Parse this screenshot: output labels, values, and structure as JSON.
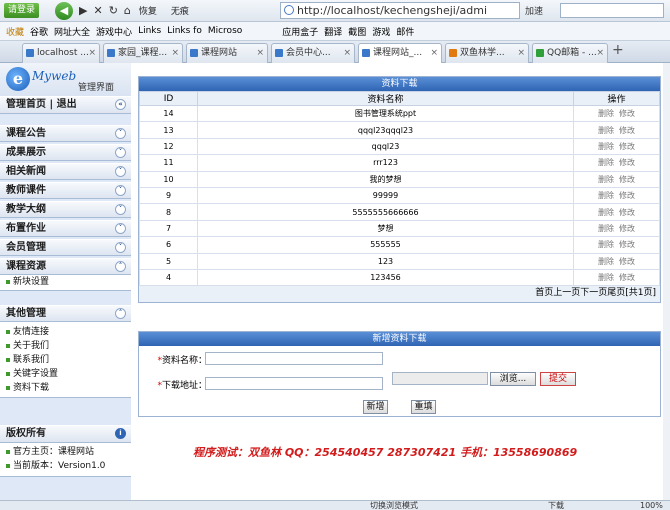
{
  "browser": {
    "login_label": "请登录",
    "back": "◀",
    "forward": "▶",
    "menu_favorites": "收藏",
    "btn_restore": "恢复",
    "btn_noplugin": "无痕",
    "address": "http://localhost/kechengsheji/admi",
    "accelerate": "加速",
    "bookmarks": [
      "收藏",
      "谷歌",
      "网址大全",
      "游戏中心",
      "Links",
      "Links fo",
      "Microso"
    ],
    "right_tools": [
      "应用盒子",
      "翻译",
      "截图",
      "游戏",
      "邮件"
    ],
    "tabs": [
      {
        "label": "localhost ...",
        "active": false
      },
      {
        "label": "家园_课程...",
        "active": false
      },
      {
        "label": "课程网站",
        "active": false
      },
      {
        "label": "会员中心...",
        "active": false
      },
      {
        "label": "课程网站_...",
        "active": true
      },
      {
        "label": "双鱼林学...",
        "active": false
      },
      {
        "label": "QQ邮箱 - ...",
        "active": false
      }
    ],
    "status_text": "切换浏览模式",
    "download_label": "下载",
    "zoom_label": "100%"
  },
  "sidebar": {
    "logo_letter": "e",
    "logo_brand": "Myweb",
    "logo_subtitle": "管理界面",
    "top_links": "管理首页 | 退出",
    "menu": [
      {
        "label": "课程公告"
      },
      {
        "label": "成果展示"
      },
      {
        "label": "相关新闻"
      },
      {
        "label": "教师课件"
      },
      {
        "label": "教学大纲"
      },
      {
        "label": "布置作业"
      },
      {
        "label": "会员管理"
      },
      {
        "label": "课程资源",
        "expanded": true
      }
    ],
    "resource_sub": [
      "新块设置"
    ],
    "other_title": "其他管理",
    "other_items": [
      "友情连接",
      "关于我们",
      "联系我们",
      "关键字设置",
      "资料下载"
    ],
    "copyright_title": "版权所有",
    "copyright_items": [
      "官方主页：课程网站",
      "当前版本：Version1.0"
    ]
  },
  "download_panel": {
    "title": "资料下载",
    "columns": [
      "ID",
      "资料名称",
      "操作"
    ],
    "rows": [
      {
        "id": "14",
        "name": "图书管理系统ppt"
      },
      {
        "id": "13",
        "name": "qqql23qqql23"
      },
      {
        "id": "12",
        "name": "qqql23"
      },
      {
        "id": "11",
        "name": "rrr123"
      },
      {
        "id": "10",
        "name": "我的梦想"
      },
      {
        "id": "9",
        "name": "99999"
      },
      {
        "id": "8",
        "name": "5555555666666"
      },
      {
        "id": "7",
        "name": "梦想"
      },
      {
        "id": "6",
        "name": "555555"
      },
      {
        "id": "5",
        "name": "123"
      },
      {
        "id": "4",
        "name": "123456"
      }
    ],
    "op_delete": "删除",
    "op_edit": "修改",
    "pager": "首页上一页下一页尾页[共1页]"
  },
  "add_panel": {
    "title": "新增资料下载",
    "name_label": "资料名称：",
    "addr_label": "下载地址：",
    "browse_label": "浏览...",
    "submit_label": "提交",
    "add_label": "新增",
    "reset_label": "重填",
    "required_mark": "*"
  },
  "tester_note": "程序测试：双鱼林  QQ：254540457  287307421    手机：13558690869"
}
